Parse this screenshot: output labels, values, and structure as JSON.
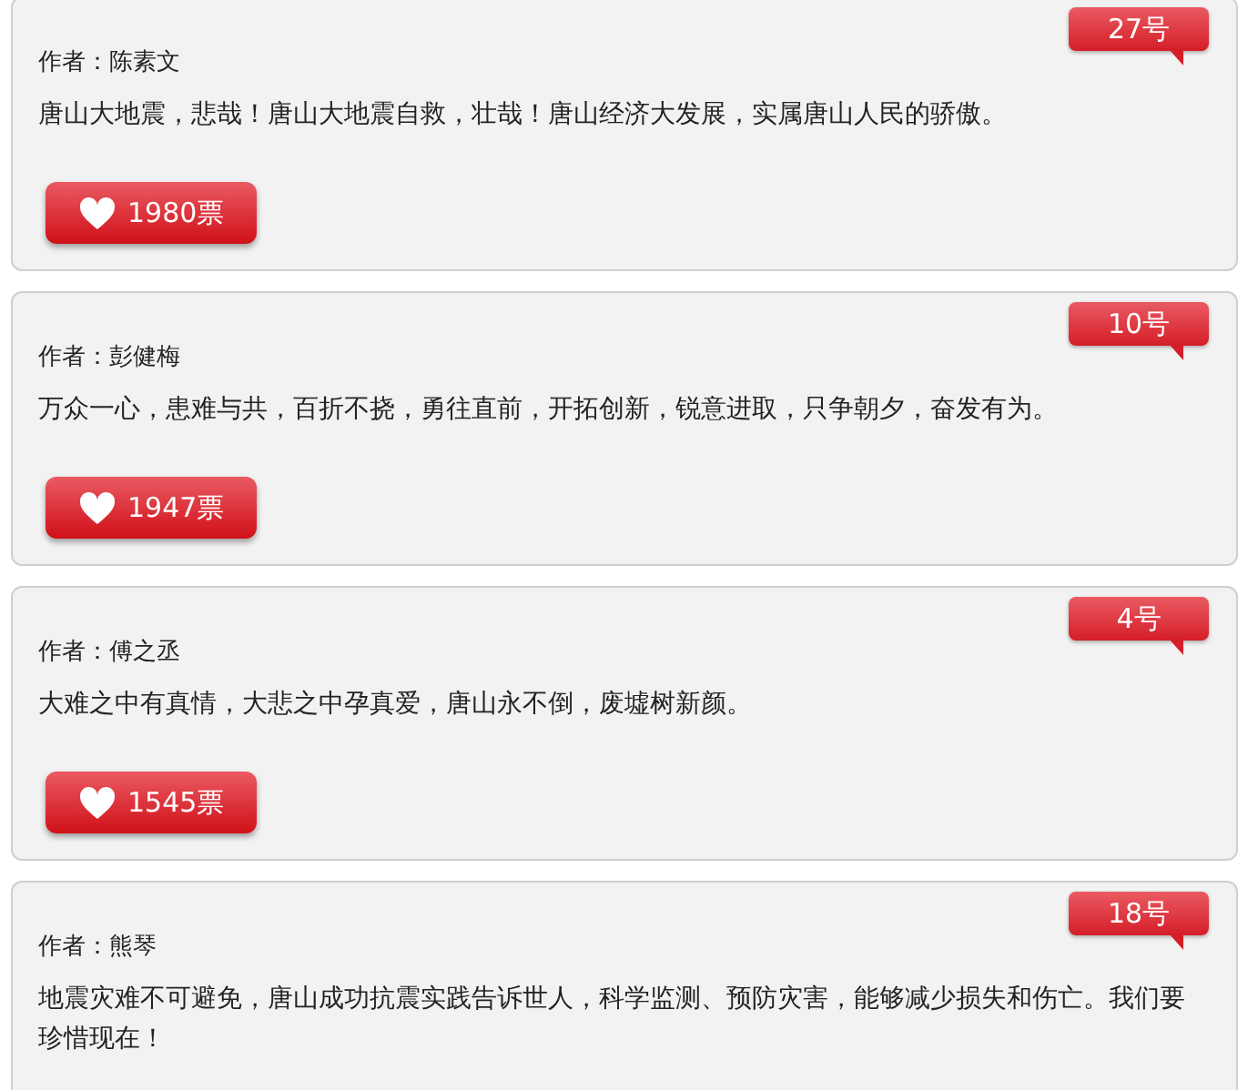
{
  "entries": [
    {
      "number": "27号",
      "author": "作者：陈素文",
      "message": "唐山大地震，悲哉！唐山大地震自救，壮哉！唐山经济大发展，实属唐山人民的骄傲。",
      "votes": "1980票"
    },
    {
      "number": "10号",
      "author": "作者：彭健梅",
      "message": "万众一心，患难与共，百折不挠，勇往直前，开拓创新，锐意进取，只争朝夕，奋发有为。",
      "votes": "1947票"
    },
    {
      "number": "4号",
      "author": "作者：傅之丞",
      "message": "大难之中有真情，大悲之中孕真爱，唐山永不倒，废墟树新颜。",
      "votes": "1545票"
    },
    {
      "number": "18号",
      "author": "作者：熊琴",
      "message": "地震灾难不可避免，唐山成功抗震实践告诉世人，科学监测、预防灾害，能够减少损失和伤亡。我们要珍惜现在！"
    }
  ]
}
